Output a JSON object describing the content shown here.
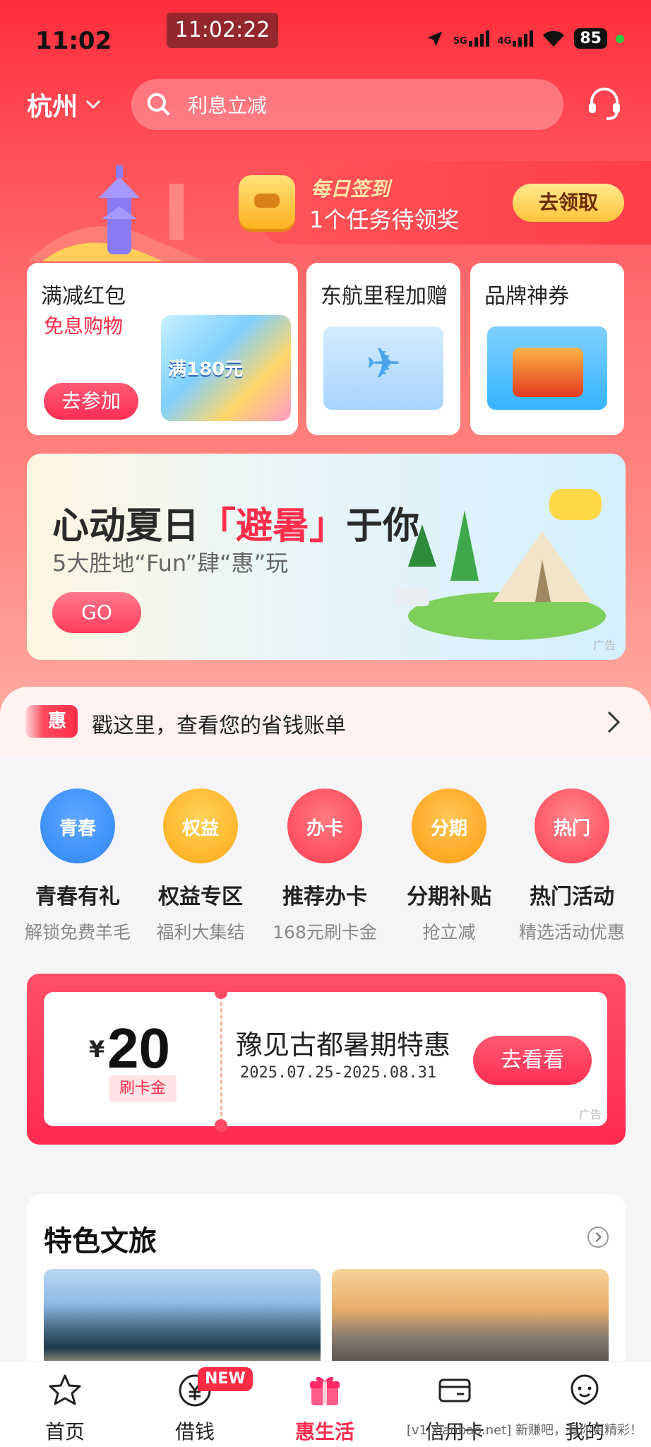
{
  "status_bar": {
    "time": "11:02",
    "recording_clock": "11:02:22",
    "battery": "85",
    "network": "5G",
    "network2": "4G"
  },
  "header": {
    "city": "杭州",
    "search_placeholder": "利息立减"
  },
  "daily_signin": {
    "title": "每日签到",
    "subtitle": "1个任务待领奖",
    "button": "去领取"
  },
  "promo_cards": [
    {
      "title": "满减红包",
      "subtitle": "免息购物",
      "button": "去参加"
    },
    {
      "title": "东航里程加赠"
    },
    {
      "title": "品牌神券"
    }
  ],
  "banner": {
    "title_prefix": "心动夏日",
    "title_highlight": "「避暑」",
    "title_suffix": "于你",
    "subtitle": "5大胜地“Fun”肆“惠”玩",
    "button": "GO",
    "ad_tag": "广告"
  },
  "bill_bar": {
    "tag": "惠",
    "text": "戳这里，查看您的省钱账单"
  },
  "quick_entries": [
    {
      "icon_text": "青春",
      "label": "青春有礼",
      "sub": "解锁免费羊毛",
      "color": "#2f86f5"
    },
    {
      "icon_text": "权益",
      "label": "权益专区",
      "sub": "福利大集结",
      "color": "#ffb11f"
    },
    {
      "icon_text": "办卡",
      "label": "推荐办卡",
      "sub": "168元刷卡金",
      "color": "#ff3b4e"
    },
    {
      "icon_text": "分期",
      "label": "分期补贴",
      "sub": "抢立减",
      "color": "#ffa313"
    },
    {
      "icon_text": "热门",
      "label": "热门活动",
      "sub": "精选活动优惠",
      "color": "#ff4455"
    }
  ],
  "coupon": {
    "currency": "¥",
    "amount": "20",
    "tag": "刷卡金",
    "title": "豫见古都暑期特惠",
    "date": "2025.07.25-2025.08.31",
    "button": "去看看",
    "ad_tag": "广告"
  },
  "culture": {
    "title": "特色文旅"
  },
  "tabbar": {
    "items": [
      {
        "label": "首页"
      },
      {
        "label": "借钱",
        "badge": "NEW"
      },
      {
        "label": "惠生活",
        "active": true
      },
      {
        "label": "信用卡"
      },
      {
        "label": "我的"
      }
    ]
  },
  "watermark": "[v1.xianbao.net] 新赚吧，有你更精彩！",
  "colors": {
    "brand_red": "#ff2c46",
    "hero_top": "#ff2e3c",
    "gold": "#ffc43a"
  }
}
